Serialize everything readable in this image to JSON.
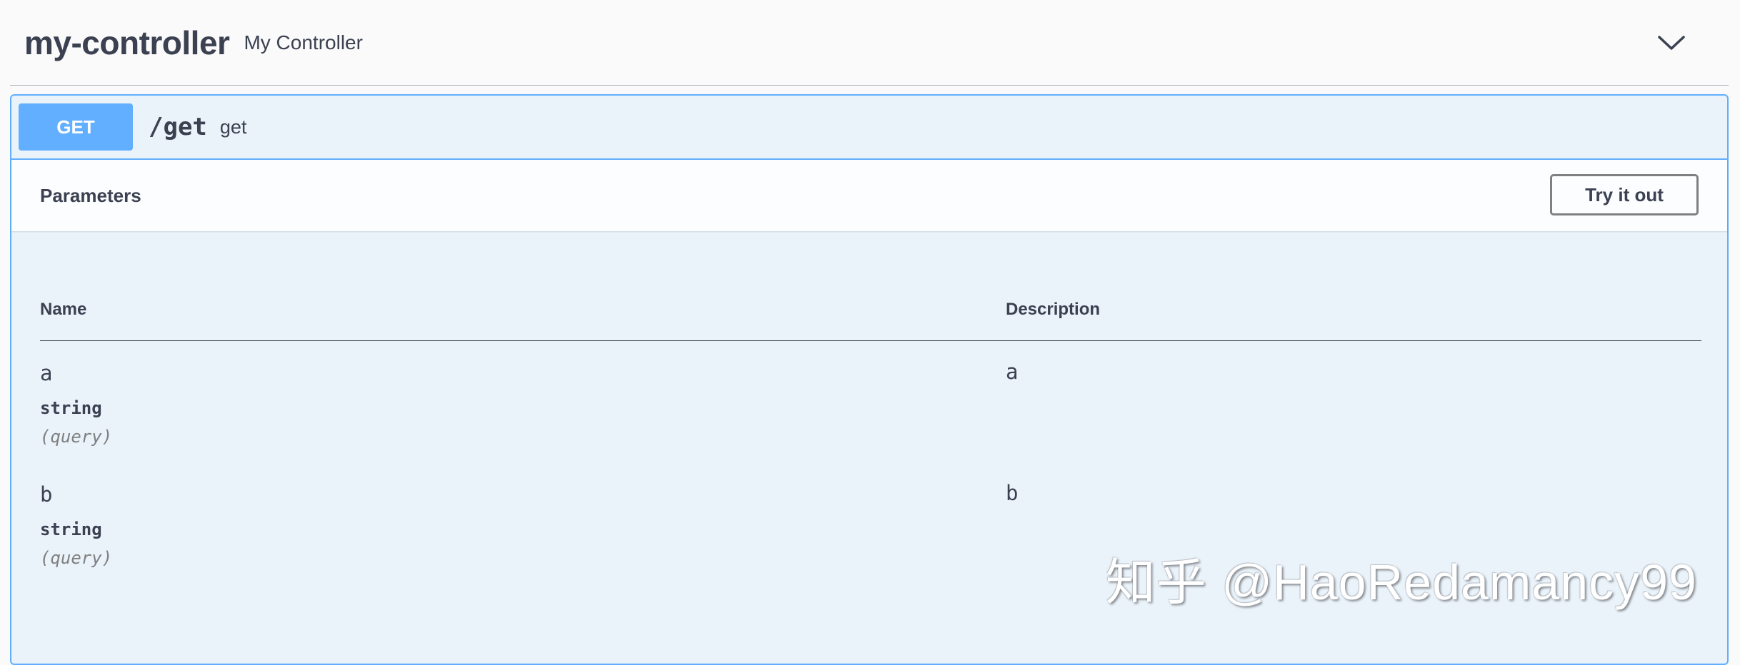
{
  "tag": {
    "name": "my-controller",
    "description": "My Controller",
    "toggle_icon": "chevron-down-icon"
  },
  "operation": {
    "method": "GET",
    "path": "/get",
    "summary": "get",
    "accent_color": "#61affe"
  },
  "parameters_section": {
    "title": "Parameters",
    "try_button_label": "Try it out",
    "columns": {
      "name": "Name",
      "description": "Description"
    },
    "rows": [
      {
        "name": "a",
        "type": "string",
        "in": "(query)",
        "description": "a"
      },
      {
        "name": "b",
        "type": "string",
        "in": "(query)",
        "description": "b"
      }
    ]
  },
  "watermark": "知乎 @HaoRedamancy99"
}
